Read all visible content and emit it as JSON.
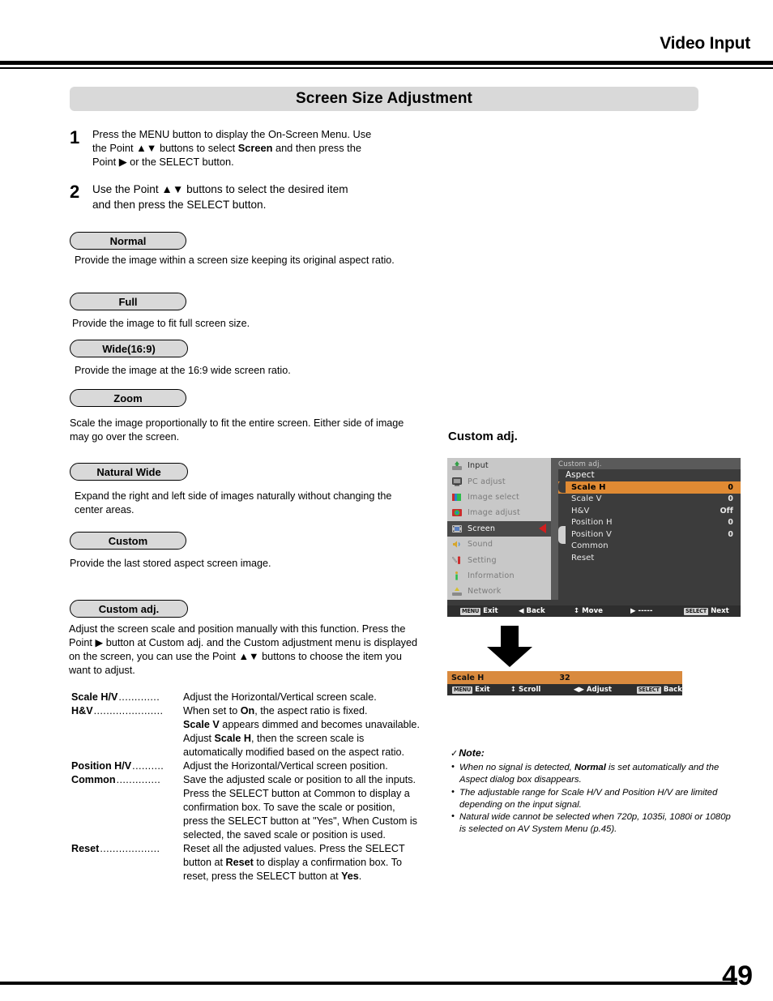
{
  "header": {
    "title": "Video Input"
  },
  "banner": {
    "title": "Screen Size Adjustment"
  },
  "steps": [
    {
      "num": "1",
      "text": "Press the MENU button to display the On-Screen Menu. Use the Point ▲▼ buttons to select Screen and then press the Point ▶ or the SELECT button."
    },
    {
      "num": "2",
      "text": "Use the Point ▲▼ buttons to select the desired item and then press the SELECT button."
    }
  ],
  "options": [
    {
      "label": "Normal",
      "desc": "Provide the image within a screen size keeping its original aspect ratio."
    },
    {
      "label": "Full",
      "desc": "Provide the image to fit full screen size."
    },
    {
      "label": "Wide(16:9)",
      "desc": "Provide the image at the 16:9 wide screen ratio."
    },
    {
      "label": "Zoom",
      "desc": "Scale the image proportionally to fit the entire screen. Either side of image may go over the screen."
    },
    {
      "label": "Natural Wide",
      "desc": "Expand the right and left side of images naturally without changing the center areas."
    },
    {
      "label": "Custom",
      "desc": "Provide the last stored aspect screen image."
    }
  ],
  "custom_adj": {
    "pill_label": "Custom adj.",
    "paragraph": "Adjust the screen scale and position manually with this function. Press the Point ▶ button at Custom adj. and the Custom adjustment menu is displayed on the screen, you can use the Point ▲▼ buttons to choose the item you want to adjust.",
    "definitions": [
      {
        "term": "Scale H/V",
        "dots": ".............",
        "def": "Adjust the Horizontal/Vertical screen scale."
      },
      {
        "term": "H&V",
        "dots": "......................",
        "def": "When set to On, the aspect ratio is fixed. Scale V appears dimmed and becomes unavailable. Adjust Scale H, then the screen scale is automatically modified based on the aspect ratio."
      },
      {
        "term": "Position H/V",
        "dots": "..........",
        "def": "Adjust the Horizontal/Vertical screen position."
      },
      {
        "term": "Common",
        "dots": "..............",
        "def": "Save the adjusted scale or position to all the inputs. Press the SELECT button at Common to display a confirmation box. To save the scale or position, press the SELECT button at \"Yes\", When Custom is selected, the saved scale or position is used."
      },
      {
        "term": "Reset",
        "dots": "...................",
        "def": "Reset all the adjusted values. Press the SELECT button at Reset to display a confirmation box. To reset, press the SELECT button at Yes."
      }
    ]
  },
  "osd": {
    "caption": "Custom adj.",
    "menu_items": [
      {
        "label": "Input",
        "icon": "input-icon",
        "state": "enabled"
      },
      {
        "label": "PC adjust",
        "icon": "pc-adjust-icon",
        "state": "dimmed"
      },
      {
        "label": "Image select",
        "icon": "image-select-icon",
        "state": "dimmed"
      },
      {
        "label": "Image adjust",
        "icon": "image-adjust-icon",
        "state": "dimmed"
      },
      {
        "label": "Screen",
        "icon": "screen-icon",
        "state": "active"
      },
      {
        "label": "Sound",
        "icon": "sound-icon",
        "state": "dimmed"
      },
      {
        "label": "Setting",
        "icon": "setting-icon",
        "state": "dimmed"
      },
      {
        "label": "Information",
        "icon": "information-icon",
        "state": "dimmed"
      },
      {
        "label": "Network",
        "icon": "network-icon",
        "state": "dimmed"
      }
    ],
    "breadcrumb": "Custom adj.",
    "panel_title": "Aspect",
    "panel_items": [
      {
        "label": "Scale H",
        "value": "0",
        "selected": true
      },
      {
        "label": "Scale V",
        "value": "0",
        "selected": false
      },
      {
        "label": "H&V",
        "value": "Off",
        "selected": false
      },
      {
        "label": "Position H",
        "value": "0",
        "selected": false
      },
      {
        "label": "Position V",
        "value": "0",
        "selected": false
      },
      {
        "label": "Common",
        "value": "",
        "selected": false
      },
      {
        "label": "Reset",
        "value": "",
        "selected": false
      }
    ],
    "footer_keys": [
      {
        "cap": "MENU",
        "glyph": "",
        "label": "Exit"
      },
      {
        "cap": "",
        "glyph": "◀",
        "label": "Back"
      },
      {
        "cap": "",
        "glyph": "↕",
        "label": "Move"
      },
      {
        "cap": "",
        "glyph": "▶",
        "label": "-----"
      },
      {
        "cap": "SELECT",
        "glyph": "",
        "label": "Next"
      }
    ],
    "highlight_color": "#e08a33",
    "panel_bg": "#3c3c3c",
    "sidebar_bg": "#c8c8c8"
  },
  "scale_strip": {
    "name": "Scale H",
    "value": "32",
    "footer_keys": [
      {
        "cap": "MENU",
        "glyph": "",
        "label": "Exit"
      },
      {
        "cap": "",
        "glyph": "↕",
        "label": "Scroll"
      },
      {
        "cap": "",
        "glyph": "◀▶",
        "label": "Adjust"
      },
      {
        "cap": "SELECT",
        "glyph": "",
        "label": "Back"
      }
    ],
    "bar_color": "#d98a3e"
  },
  "note": {
    "title": "Note:",
    "check": "✓",
    "items": [
      "When no signal is detected, Normal is set automatically and the Aspect dialog box disappears.",
      "The adjustable range for Scale H/V and Position H/V are limited depending on the input signal.",
      "Natural wide cannot be selected when 720p, 1035i, 1080i or 1080p is selected on AV System Menu (p.45)."
    ]
  },
  "footer": {
    "page_number": "49"
  }
}
